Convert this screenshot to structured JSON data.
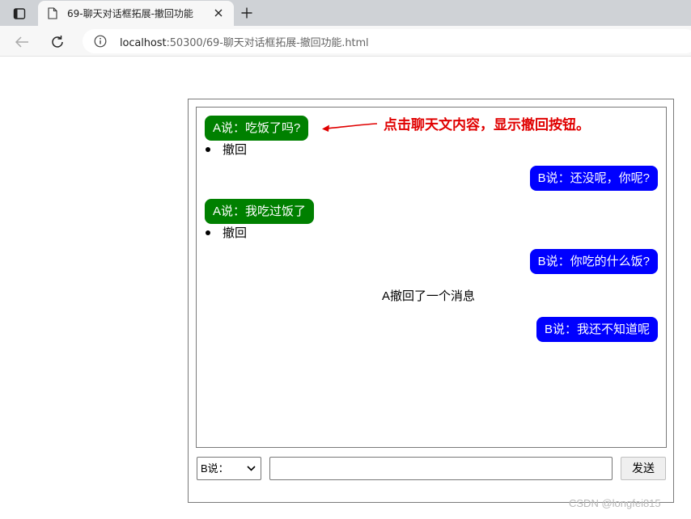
{
  "browser": {
    "tab_title": "69-聊天对话框拓展-撤回功能",
    "url_host": "localhost",
    "url_rest": ":50300/69-聊天对话框拓展-撤回功能.html"
  },
  "chat": {
    "messages": [
      {
        "text": "A说：吃饭了吗?"
      },
      {
        "text": "撤回"
      },
      {
        "text": "B说：还没呢，你呢?"
      },
      {
        "text": "A说：我吃过饭了"
      },
      {
        "text": "撤回"
      },
      {
        "text": "B说：你吃的什么饭?"
      },
      {
        "text": "A撤回了一个消息"
      },
      {
        "text": "B说：我还不知道呢"
      }
    ]
  },
  "controls": {
    "speaker_selected": "B说：",
    "message_value": "",
    "send_label": "发送"
  },
  "annotation": "点击聊天文内容，显示撤回按钮。",
  "watermark": "CSDN @longfei815",
  "colors": {
    "a_bubble": "#008000",
    "b_bubble": "#0000ff",
    "annotation": "#e00000"
  }
}
